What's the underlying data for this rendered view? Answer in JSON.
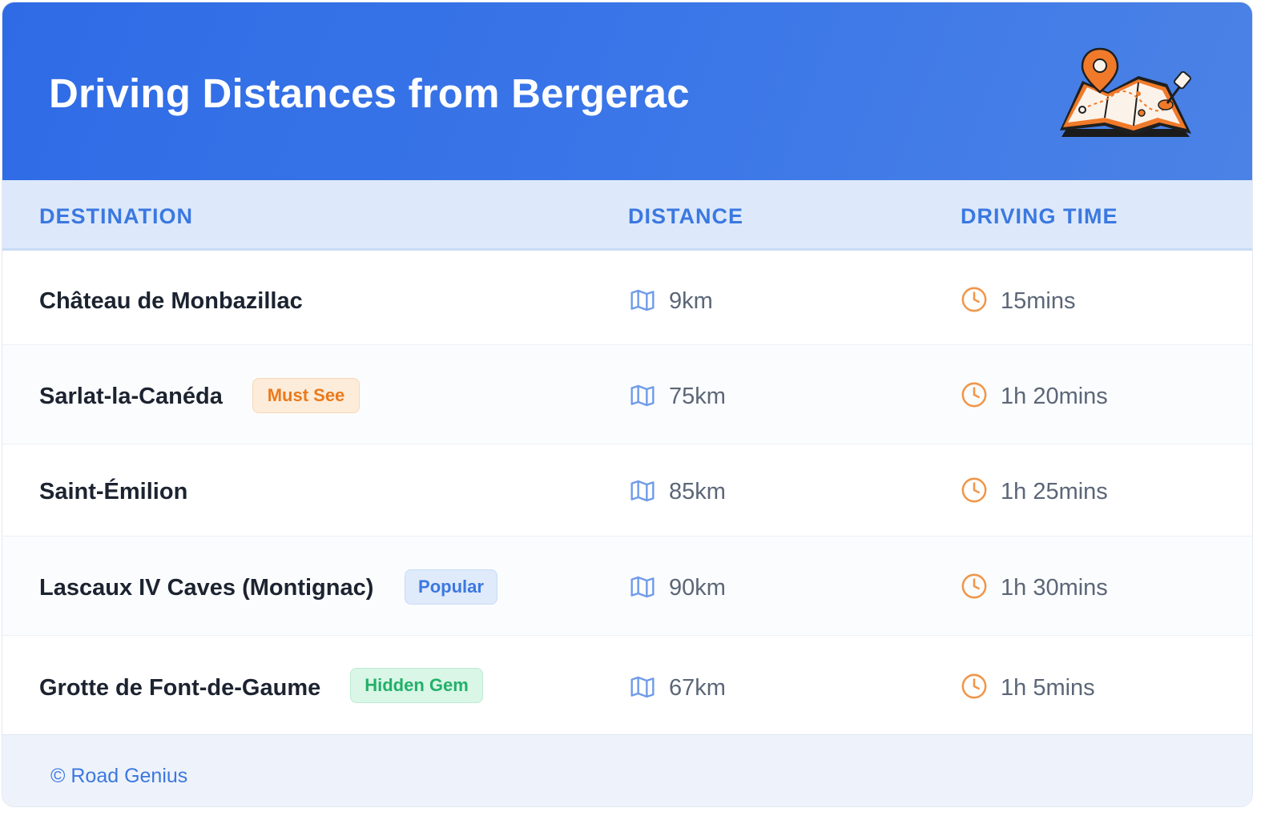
{
  "header": {
    "title": "Driving Distances from Bergerac",
    "illustration_icon": "folded-map-with-location-pin-icon"
  },
  "colors": {
    "header_blue": "#3a76e8",
    "accent_blue": "#3b78e0",
    "clock_orange": "#f0964a",
    "badge_orange": "#ea7a1c",
    "badge_green": "#23b06a"
  },
  "table": {
    "columns": [
      "DESTINATION",
      "DISTANCE",
      "DRIVING TIME"
    ],
    "distance_icon": "map-icon",
    "time_icon": "clock-icon",
    "rows": [
      {
        "destination": "Château de Monbazillac",
        "badge": null,
        "distance": "9km",
        "time": "15mins"
      },
      {
        "destination": "Sarlat-la-Canéda",
        "badge": "Must See",
        "badge_color": "orange",
        "distance": "75km",
        "time": "1h 20mins"
      },
      {
        "destination": "Saint-Émilion",
        "badge": null,
        "distance": "85km",
        "time": "1h 25mins"
      },
      {
        "destination": "Lascaux IV Caves (Montignac)",
        "badge": "Popular",
        "badge_color": "blue",
        "distance": "90km",
        "time": "1h 30mins"
      },
      {
        "destination": "Grotte de Font-de-Gaume",
        "badge": "Hidden Gem",
        "badge_color": "green",
        "distance": "67km",
        "time": "1h 5mins"
      }
    ]
  },
  "footer": {
    "text": "© Road Genius"
  }
}
